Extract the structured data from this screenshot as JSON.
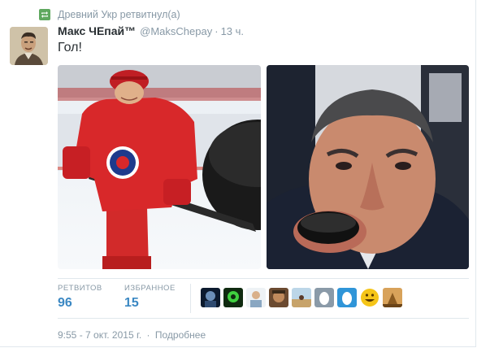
{
  "retweet": {
    "icon": "retweet-icon",
    "text": "Древний Укр ретвитнул(а)"
  },
  "tweet": {
    "author_name": "Макс ЧЕпай™",
    "handle": "@MaksChepay",
    "separator": "·",
    "time": "13 ч.",
    "text": "Гол!"
  },
  "stats": {
    "retweets_label": "РЕТВИТОВ",
    "retweets_count": "96",
    "favorites_label": "ИЗБРАННОЕ",
    "favorites_count": "15"
  },
  "footer": {
    "date": "9:55 - 7 окт. 2015 г.",
    "separator": "·",
    "details_link": "Подробнее"
  },
  "colors": {
    "accent": "#3b88c3",
    "muted": "#8899a6",
    "text": "#292f33",
    "retweet_green": "#5fa85f"
  }
}
